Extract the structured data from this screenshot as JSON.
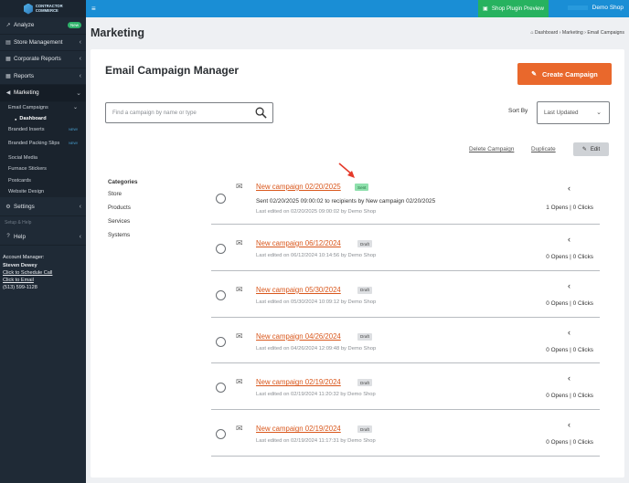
{
  "brand": {
    "logo_text": "CONTRACTOR COMMERCE"
  },
  "topbar": {
    "menu_icon": "hamburger-icon",
    "preview_label": "Shop Plugin Preview",
    "shop_name": "Demo Shop"
  },
  "sidebar": {
    "items": [
      {
        "label": "Analyze",
        "badge": "New",
        "icon": "chart-icon"
      },
      {
        "label": "Store Management",
        "icon": "store-icon"
      },
      {
        "label": "Corporate Reports",
        "icon": "reports-icon"
      },
      {
        "label": "Reports",
        "icon": "reports-icon"
      },
      {
        "label": "Marketing",
        "icon": "megaphone-icon"
      }
    ],
    "marketing_sub": {
      "email_campaigns": "Email Campaigns",
      "dashboard": "Dashboard",
      "branded_inserts": "Branded Inserts",
      "branded_inserts_tag": "NEW!",
      "branded_packing_slips": "Branded Packing Slips",
      "branded_packing_slips_tag": "NEW!",
      "social_media": "Social Media",
      "furnace_stickers": "Furnace Stickers",
      "postcards": "Postcards",
      "website_design": "Website Design"
    },
    "settings_label": "Settings",
    "setup_help_label": "Setup & Help",
    "help_label": "Help",
    "account": {
      "title": "Account Manager:",
      "name": "Steven Dewey",
      "schedule": "Click to Schedule Call",
      "email": "Click to Email",
      "phone": "(513) 599-1128"
    }
  },
  "page": {
    "title": "Marketing",
    "breadcrumb": [
      "Dashboard",
      "Marketing",
      "Email Campaigns"
    ]
  },
  "card": {
    "title": "Email Campaign Manager",
    "create_label": "Create Campaign",
    "search_placeholder": "Find a campaign by name or type",
    "sort_label": "Sort By",
    "sort_value": "Last Updated",
    "delete_label": "Delete Campaign",
    "duplicate_label": "Duplicate",
    "edit_label": "Edit"
  },
  "categories": {
    "heading": "Categories",
    "items": [
      "Store",
      "Products",
      "Services",
      "Systems"
    ]
  },
  "campaigns": [
    {
      "name": "New campaign 02/20/2025",
      "status": "Sent",
      "sent_info": "Sent 02/20/2025 09:00:02 to recipients by New campaign 02/20/2025",
      "edited": "Last edited on 02/20/2025 09:00:02 by Demo Shop",
      "stats": "1 Opens | 0 Clicks"
    },
    {
      "name": "New campaign 06/12/2024",
      "status": "Draft",
      "edited": "Last edited on 06/12/2024 10:14:56 by Demo Shop",
      "stats": "0 Opens | 0 Clicks"
    },
    {
      "name": "New campaign 05/30/2024",
      "status": "Draft",
      "edited": "Last edited on 05/30/2024 10:09:12 by Demo Shop",
      "stats": "0 Opens | 0 Clicks"
    },
    {
      "name": "New campaign 04/26/2024",
      "status": "Draft",
      "edited": "Last edited on 04/26/2024 12:09:48 by Demo Shop",
      "stats": "0 Opens | 0 Clicks"
    },
    {
      "name": "New campaign 02/19/2024",
      "status": "Draft",
      "edited": "Last edited on 02/19/2024 11:20:32 by Demo Shop",
      "stats": "0 Opens | 0 Clicks"
    },
    {
      "name": "New campaign 02/19/2024",
      "status": "Draft",
      "edited": "Last edited on 02/19/2024 11:17:31 by Demo Shop",
      "stats": "0 Opens | 0 Clicks"
    }
  ],
  "colors": {
    "topbar": "#1a8ed5",
    "sidebar": "#1f2a36",
    "accent": "#e9682c",
    "preview": "#27b25f"
  }
}
